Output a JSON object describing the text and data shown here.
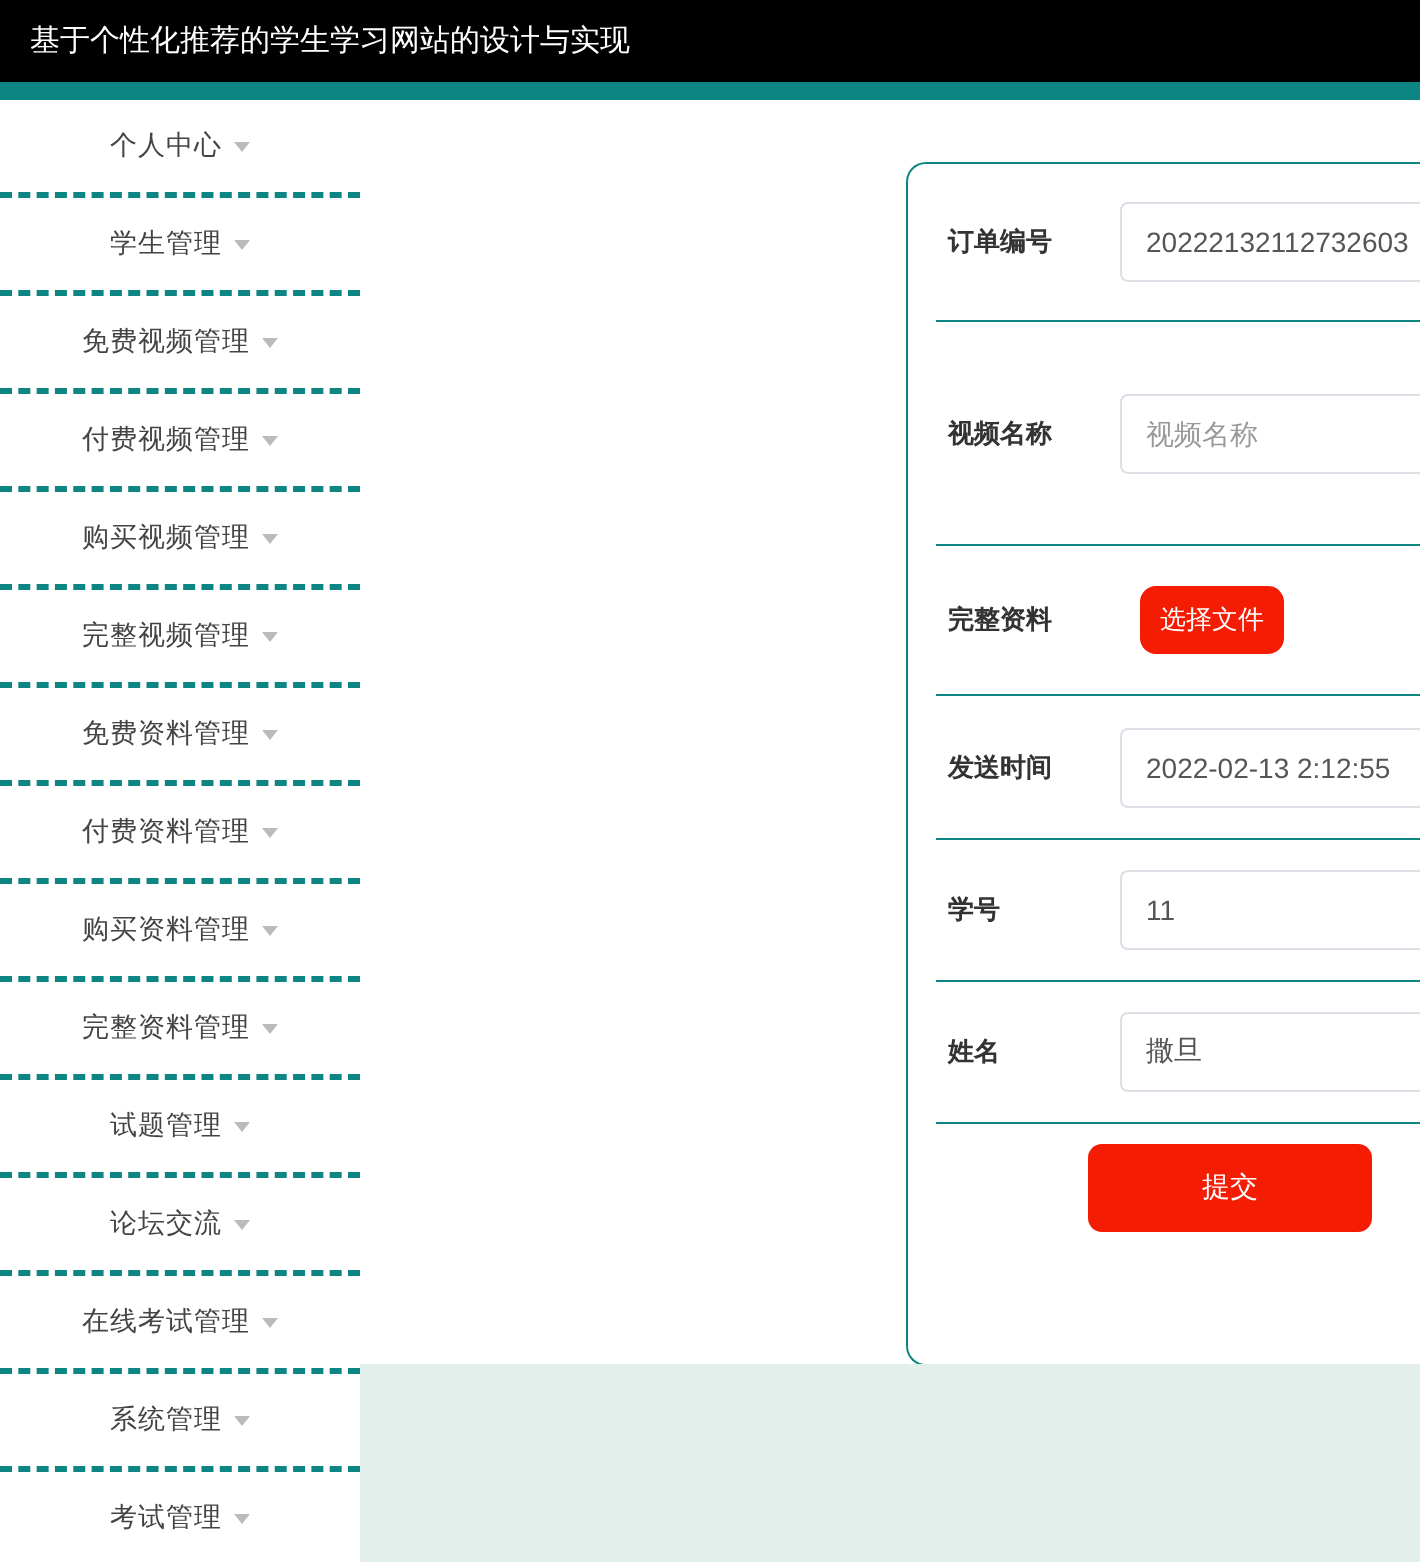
{
  "header": {
    "title": "基于个性化推荐的学生学习网站的设计与实现"
  },
  "sidebar": {
    "items": [
      {
        "label": "个人中心"
      },
      {
        "label": "学生管理"
      },
      {
        "label": "免费视频管理"
      },
      {
        "label": "付费视频管理"
      },
      {
        "label": "购买视频管理"
      },
      {
        "label": "完整视频管理"
      },
      {
        "label": "免费资料管理"
      },
      {
        "label": "付费资料管理"
      },
      {
        "label": "购买资料管理"
      },
      {
        "label": "完整资料管理"
      },
      {
        "label": "试题管理"
      },
      {
        "label": "论坛交流"
      },
      {
        "label": "在线考试管理"
      },
      {
        "label": "系统管理"
      },
      {
        "label": "考试管理"
      }
    ]
  },
  "form": {
    "fields": [
      {
        "kind": "text",
        "label": "订单编号",
        "value": "20222132112732603"
      },
      {
        "kind": "text",
        "label": "视频名称",
        "placeholder": "视频名称"
      },
      {
        "kind": "file",
        "label": "完整资料",
        "button": "选择文件"
      },
      {
        "kind": "text",
        "label": "发送时间",
        "value": "2022-02-13 2:12:55"
      },
      {
        "kind": "text",
        "label": "学号",
        "value": "11"
      },
      {
        "kind": "text",
        "label": "姓名",
        "value": "撒旦"
      }
    ],
    "submit": "提交"
  }
}
